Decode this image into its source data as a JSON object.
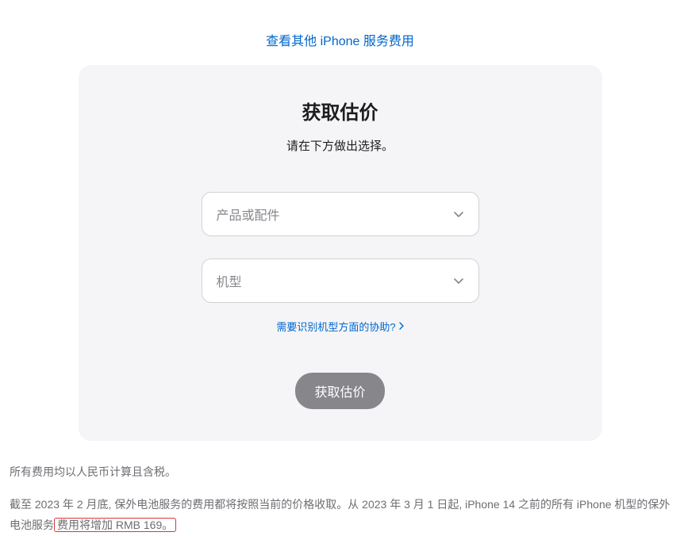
{
  "topLink": {
    "text": "查看其他 iPhone 服务费用"
  },
  "card": {
    "title": "获取估价",
    "subtitle": "请在下方做出选择。",
    "select1": {
      "placeholder": "产品或配件"
    },
    "select2": {
      "placeholder": "机型"
    },
    "helpLink": "需要识别机型方面的协助?",
    "submitButton": "获取估价"
  },
  "footer": {
    "line1": "所有费用均以人民币计算且含税。",
    "line2_part1": "截至 2023 年 2 月底, 保外电池服务的费用都将按照当前的价格收取。从 2023 年 3 月 1 日起, iPhone 14 之前的所有 iPhone 机型的保外电池服务",
    "line2_highlight": "费用将增加 RMB 169。"
  }
}
